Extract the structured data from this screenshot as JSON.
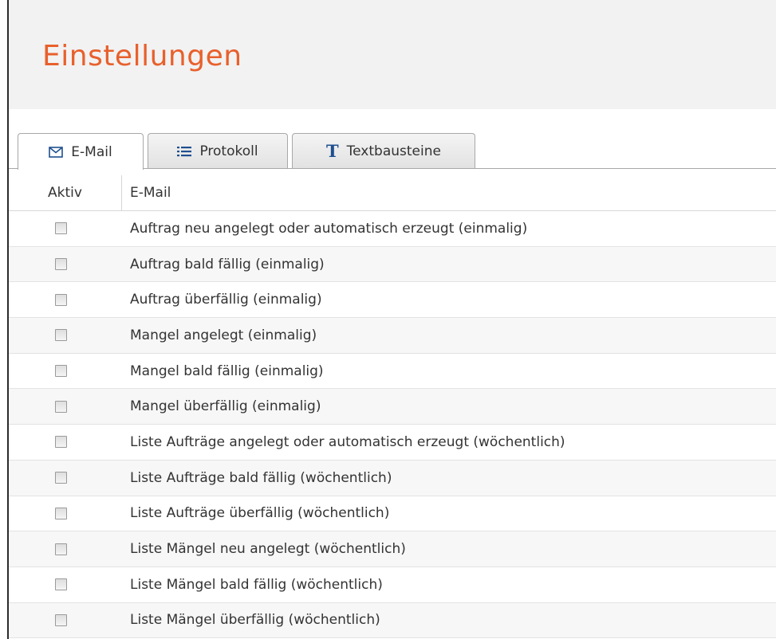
{
  "page": {
    "title": "Einstellungen"
  },
  "tabs": [
    {
      "label": "E-Mail",
      "icon": "envelope-icon",
      "active": true
    },
    {
      "label": "Protokoll",
      "icon": "list-icon",
      "active": false
    },
    {
      "label": "Textbausteine",
      "icon": "text-T-icon",
      "icon_glyph": "T",
      "active": false
    }
  ],
  "table": {
    "headers": {
      "aktiv": "Aktiv",
      "email": "E-Mail"
    },
    "rows": [
      {
        "checked": false,
        "label": "Auftrag neu angelegt oder automatisch erzeugt (einmalig)"
      },
      {
        "checked": false,
        "label": "Auftrag bald fällig (einmalig)"
      },
      {
        "checked": false,
        "label": "Auftrag überfällig (einmalig)"
      },
      {
        "checked": false,
        "label": "Mangel angelegt (einmalig)"
      },
      {
        "checked": false,
        "label": "Mangel bald fällig (einmalig)"
      },
      {
        "checked": false,
        "label": "Mangel überfällig (einmalig)"
      },
      {
        "checked": false,
        "label": "Liste Aufträge angelegt oder automatisch erzeugt (wöchentlich)"
      },
      {
        "checked": false,
        "label": "Liste Aufträge bald fällig (wöchentlich)"
      },
      {
        "checked": false,
        "label": "Liste Aufträge überfällig (wöchentlich)"
      },
      {
        "checked": false,
        "label": "Liste Mängel neu angelegt (wöchentlich)"
      },
      {
        "checked": false,
        "label": "Liste Mängel bald fällig (wöchentlich)"
      },
      {
        "checked": false,
        "label": "Liste Mängel überfällig (wöchentlich)"
      }
    ]
  },
  "colors": {
    "title": "#e8602c",
    "header_bg": "#f2f2f2",
    "icon_blue": "#1e4f8f"
  }
}
